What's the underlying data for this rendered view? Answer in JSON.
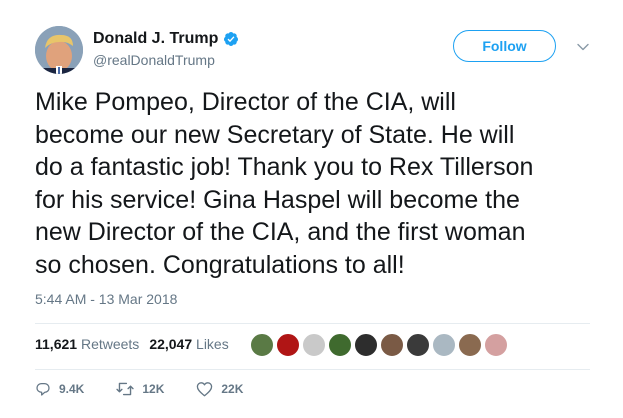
{
  "author": {
    "name": "Donald J. Trump",
    "handle": "@realDonaldTrump",
    "verified": true
  },
  "follow_label": "Follow",
  "tweet_text": "Mike Pompeo, Director of the CIA, will\nbecome our new Secretary of State. He will\ndo a fantastic job! Thank you to Rex Tillerson\nfor his service! Gina Haspel will become the\nnew Director of the CIA, and the first woman\nso chosen. Congratulations to all!",
  "timestamp": "5:44 AM - 13 Mar 2018",
  "stats": {
    "retweets": {
      "value": "11,621",
      "label": "Retweets"
    },
    "likes": {
      "value": "22,047",
      "label": "Likes"
    }
  },
  "liker_avatars": [
    {
      "color": "#5a7a45"
    },
    {
      "color": "#b01515"
    },
    {
      "color": "#c9c9c9"
    },
    {
      "color": "#3f6a2e"
    },
    {
      "color": "#2d2d2d"
    },
    {
      "color": "#7a5a45"
    },
    {
      "color": "#3a3a3a"
    },
    {
      "color": "#aab8c2"
    },
    {
      "color": "#8a6a50"
    },
    {
      "color": "#d4a0a0"
    }
  ],
  "actions": {
    "replies": "9.4K",
    "retweets": "12K",
    "likes": "22K"
  },
  "colors": {
    "brand_blue": "#1da1f2",
    "secondary_text": "#657786",
    "primary_text": "#14171a",
    "divider": "#e6ecf0"
  },
  "icons": {
    "verified": "verified-badge-icon",
    "caret": "chevron-down-icon",
    "reply": "reply-icon",
    "retweet": "retweet-icon",
    "like": "heart-icon"
  }
}
